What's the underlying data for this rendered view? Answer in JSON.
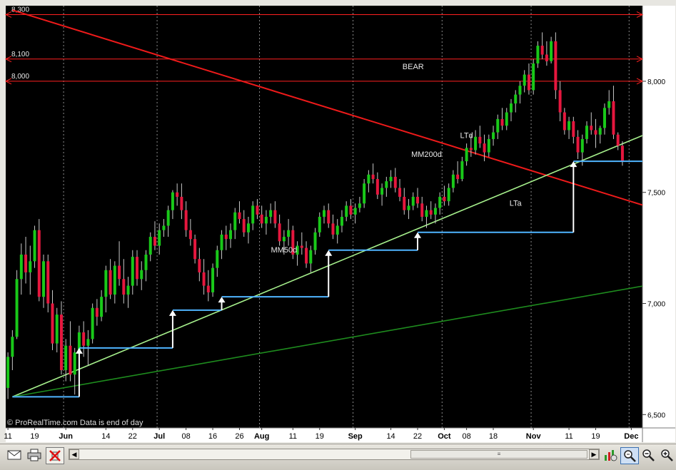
{
  "chart_data": {
    "type": "candlestick",
    "watermark": "© ProRealTime.com  Data is end of day",
    "y_axis": {
      "ticks": [
        6500,
        7000,
        7500,
        8000
      ],
      "tick_labels": [
        "6,500",
        "7,000",
        "7,500",
        "8,000"
      ],
      "range": [
        6440,
        8340
      ],
      "position": "right"
    },
    "x_axis": {
      "labels": [
        {
          "text": "11",
          "bar": 0
        },
        {
          "text": "19",
          "bar": 6
        },
        {
          "text": "Jun",
          "bar": 13,
          "bold": true
        },
        {
          "text": "14",
          "bar": 22
        },
        {
          "text": "22",
          "bar": 28
        },
        {
          "text": "Jul",
          "bar": 34,
          "bold": true
        },
        {
          "text": "08",
          "bar": 40
        },
        {
          "text": "16",
          "bar": 46
        },
        {
          "text": "26",
          "bar": 52
        },
        {
          "text": "Aug",
          "bar": 57,
          "bold": true
        },
        {
          "text": "11",
          "bar": 64
        },
        {
          "text": "19",
          "bar": 70
        },
        {
          "text": "Sep",
          "bar": 78,
          "bold": true
        },
        {
          "text": "14",
          "bar": 86
        },
        {
          "text": "22",
          "bar": 92
        },
        {
          "text": "Oct",
          "bar": 98,
          "bold": true
        },
        {
          "text": "08",
          "bar": 103
        },
        {
          "text": "18",
          "bar": 109
        },
        {
          "text": "Nov",
          "bar": 118,
          "bold": true
        },
        {
          "text": "11",
          "bar": 126
        },
        {
          "text": "19",
          "bar": 132
        },
        {
          "text": "Dec",
          "bar": 140,
          "bold": true
        }
      ],
      "month_separators": [
        13,
        34,
        57,
        78,
        98,
        118,
        140
      ],
      "total_bars": 143
    },
    "candles": [
      [
        6620,
        6780,
        6570,
        6760
      ],
      [
        6760,
        6880,
        6700,
        6850
      ],
      [
        6850,
        7150,
        6840,
        7110
      ],
      [
        7110,
        7270,
        7040,
        7220
      ],
      [
        7220,
        7300,
        7090,
        7140
      ],
      [
        7140,
        7260,
        7040,
        7190
      ],
      [
        7190,
        7350,
        7160,
        7330
      ],
      [
        7330,
        7380,
        7010,
        7030
      ],
      [
        7030,
        7220,
        6980,
        7190
      ],
      [
        7190,
        7220,
        6960,
        7000
      ],
      [
        7000,
        7060,
        6790,
        6820
      ],
      [
        6820,
        6980,
        6780,
        6950
      ],
      [
        6950,
        7010,
        6680,
        6700
      ],
      [
        6700,
        6840,
        6650,
        6810
      ],
      [
        6810,
        6920,
        6650,
        6680
      ],
      [
        6680,
        6800,
        6590,
        6780
      ],
      [
        6780,
        6900,
        6740,
        6870
      ],
      [
        6870,
        6920,
        6760,
        6810
      ],
      [
        6810,
        6880,
        6720,
        6840
      ],
      [
        6840,
        7000,
        6820,
        6980
      ],
      [
        6980,
        7020,
        6900,
        6940
      ],
      [
        6940,
        7060,
        6920,
        7030
      ],
      [
        7030,
        7170,
        6960,
        7150
      ],
      [
        7150,
        7200,
        7020,
        7040
      ],
      [
        7040,
        7190,
        7000,
        7170
      ],
      [
        7170,
        7280,
        7080,
        7110
      ],
      [
        7110,
        7200,
        7000,
        7040
      ],
      [
        7040,
        7120,
        6980,
        7080
      ],
      [
        7080,
        7240,
        7040,
        7210
      ],
      [
        7210,
        7240,
        7080,
        7110
      ],
      [
        7110,
        7190,
        7060,
        7150
      ],
      [
        7150,
        7240,
        7100,
        7220
      ],
      [
        7220,
        7320,
        7190,
        7300
      ],
      [
        7300,
        7370,
        7240,
        7260
      ],
      [
        7260,
        7360,
        7220,
        7330
      ],
      [
        7330,
        7380,
        7300,
        7350
      ],
      [
        7350,
        7440,
        7300,
        7420
      ],
      [
        7420,
        7510,
        7380,
        7500
      ],
      [
        7500,
        7540,
        7440,
        7480
      ],
      [
        7480,
        7540,
        7380,
        7420
      ],
      [
        7420,
        7460,
        7300,
        7330
      ],
      [
        7330,
        7380,
        7260,
        7290
      ],
      [
        7290,
        7310,
        7180,
        7200
      ],
      [
        7200,
        7250,
        7100,
        7140
      ],
      [
        7140,
        7200,
        7040,
        7080
      ],
      [
        7080,
        7150,
        7010,
        7050
      ],
      [
        7050,
        7180,
        7030,
        7160
      ],
      [
        7160,
        7260,
        7120,
        7240
      ],
      [
        7240,
        7330,
        7200,
        7310
      ],
      [
        7310,
        7350,
        7240,
        7290
      ],
      [
        7290,
        7360,
        7250,
        7330
      ],
      [
        7330,
        7430,
        7290,
        7410
      ],
      [
        7410,
        7460,
        7360,
        7380
      ],
      [
        7380,
        7420,
        7300,
        7320
      ],
      [
        7320,
        7390,
        7270,
        7360
      ],
      [
        7360,
        7460,
        7330,
        7440
      ],
      [
        7440,
        7470,
        7380,
        7400
      ],
      [
        7400,
        7440,
        7340,
        7360
      ],
      [
        7360,
        7420,
        7310,
        7390
      ],
      [
        7390,
        7450,
        7360,
        7420
      ],
      [
        7420,
        7460,
        7340,
        7360
      ],
      [
        7360,
        7400,
        7260,
        7280
      ],
      [
        7280,
        7330,
        7220,
        7300
      ],
      [
        7300,
        7380,
        7260,
        7330
      ],
      [
        7330,
        7350,
        7200,
        7220
      ],
      [
        7220,
        7280,
        7170,
        7260
      ],
      [
        7260,
        7320,
        7220,
        7250
      ],
      [
        7250,
        7280,
        7160,
        7180
      ],
      [
        7180,
        7260,
        7140,
        7240
      ],
      [
        7240,
        7340,
        7220,
        7320
      ],
      [
        7320,
        7410,
        7300,
        7390
      ],
      [
        7390,
        7440,
        7360,
        7420
      ],
      [
        7420,
        7450,
        7340,
        7360
      ],
      [
        7360,
        7400,
        7290,
        7310
      ],
      [
        7310,
        7380,
        7270,
        7350
      ],
      [
        7350,
        7420,
        7320,
        7390
      ],
      [
        7390,
        7460,
        7370,
        7440
      ],
      [
        7440,
        7470,
        7380,
        7400
      ],
      [
        7400,
        7450,
        7360,
        7430
      ],
      [
        7430,
        7480,
        7410,
        7450
      ],
      [
        7450,
        7560,
        7430,
        7540
      ],
      [
        7540,
        7600,
        7500,
        7580
      ],
      [
        7580,
        7630,
        7540,
        7560
      ],
      [
        7560,
        7590,
        7470,
        7490
      ],
      [
        7490,
        7540,
        7440,
        7520
      ],
      [
        7520,
        7570,
        7480,
        7550
      ],
      [
        7550,
        7600,
        7520,
        7570
      ],
      [
        7570,
        7610,
        7500,
        7520
      ],
      [
        7520,
        7560,
        7460,
        7480
      ],
      [
        7480,
        7520,
        7400,
        7420
      ],
      [
        7420,
        7470,
        7380,
        7440
      ],
      [
        7440,
        7500,
        7420,
        7480
      ],
      [
        7480,
        7520,
        7430,
        7450
      ],
      [
        7450,
        7480,
        7370,
        7390
      ],
      [
        7390,
        7440,
        7340,
        7420
      ],
      [
        7420,
        7460,
        7380,
        7400
      ],
      [
        7400,
        7450,
        7360,
        7430
      ],
      [
        7430,
        7500,
        7400,
        7480
      ],
      [
        7480,
        7530,
        7440,
        7460
      ],
      [
        7460,
        7540,
        7440,
        7520
      ],
      [
        7520,
        7600,
        7500,
        7580
      ],
      [
        7580,
        7640,
        7540,
        7560
      ],
      [
        7560,
        7660,
        7550,
        7640
      ],
      [
        7640,
        7720,
        7620,
        7700
      ],
      [
        7700,
        7760,
        7660,
        7690
      ],
      [
        7690,
        7780,
        7670,
        7750
      ],
      [
        7750,
        7800,
        7700,
        7720
      ],
      [
        7720,
        7760,
        7640,
        7680
      ],
      [
        7680,
        7760,
        7660,
        7740
      ],
      [
        7740,
        7800,
        7710,
        7770
      ],
      [
        7770,
        7850,
        7740,
        7830
      ],
      [
        7830,
        7880,
        7780,
        7800
      ],
      [
        7800,
        7880,
        7780,
        7860
      ],
      [
        7860,
        7920,
        7820,
        7900
      ],
      [
        7900,
        7960,
        7860,
        7940
      ],
      [
        7940,
        8000,
        7900,
        7980
      ],
      [
        7980,
        8050,
        7950,
        8030
      ],
      [
        8030,
        8080,
        7940,
        7960
      ],
      [
        7960,
        8100,
        7940,
        8080
      ],
      [
        8080,
        8180,
        8060,
        8160
      ],
      [
        8160,
        8220,
        8100,
        8120
      ],
      [
        8120,
        8180,
        8070,
        8090
      ],
      [
        8090,
        8200,
        8080,
        8180
      ],
      [
        8180,
        8220,
        7920,
        7960
      ],
      [
        7960,
        8000,
        7820,
        7860
      ],
      [
        7860,
        7880,
        7760,
        7780
      ],
      [
        7780,
        7840,
        7740,
        7820
      ],
      [
        7820,
        7840,
        7720,
        7750
      ],
      [
        7750,
        7780,
        7650,
        7680
      ],
      [
        7680,
        7760,
        7620,
        7740
      ],
      [
        7740,
        7820,
        7720,
        7800
      ],
      [
        7800,
        7860,
        7760,
        7780
      ],
      [
        7780,
        7830,
        7700,
        7760
      ],
      [
        7760,
        7800,
        7720,
        7790
      ],
      [
        7790,
        7900,
        7760,
        7880
      ],
      [
        7880,
        7960,
        7850,
        7910
      ],
      [
        7910,
        7980,
        7740,
        7760
      ],
      [
        7760,
        7770,
        7690,
        7710
      ],
      [
        7710,
        7730,
        7620,
        7640
      ]
    ],
    "candle_colors": {
      "up": "#19c919",
      "down": "#e6173e",
      "wick": "#c8c8c8"
    },
    "horizontal_levels": [
      {
        "value": 8300,
        "label": "8,300",
        "color": "#ff2020"
      },
      {
        "value": 8100,
        "label": "8,100",
        "color": "#ff2020"
      },
      {
        "value": 8000,
        "label": "8,000",
        "color": "#ff2020"
      }
    ],
    "annotations": [
      {
        "text": "BEAR",
        "bar": 91,
        "value": 8055
      },
      {
        "text": "LTd",
        "bar": 103,
        "value": 7745
      },
      {
        "text": "MM200d",
        "bar": 94,
        "value": 7660
      },
      {
        "text": "MM50d",
        "bar": 62,
        "value": 7230
      },
      {
        "text": "LTa",
        "bar": 114,
        "value": 7440
      }
    ],
    "trend_lines": [
      {
        "name": "LTd",
        "color": "#ee1a1a",
        "points": [
          [
            1,
            8320
          ],
          [
            143,
            7440
          ]
        ]
      },
      {
        "name": "LTa",
        "color": "#a6f08c",
        "points": [
          [
            1,
            6580
          ],
          [
            143,
            7760
          ]
        ]
      },
      {
        "name": "MM200d",
        "color": "#1e8c1e",
        "points": [
          [
            1,
            6580
          ],
          [
            143,
            7080
          ]
        ]
      }
    ],
    "staircase": {
      "color": "#4fb4ff",
      "steps": [
        [
          1,
          16,
          6580
        ],
        [
          16,
          37,
          6800
        ],
        [
          37,
          48,
          6970
        ],
        [
          48,
          72,
          7030
        ],
        [
          72,
          92,
          7240
        ],
        [
          92,
          127,
          7320
        ],
        [
          127,
          143,
          7640
        ]
      ],
      "arrows": [
        {
          "bar": 16,
          "from": 6580,
          "to": 6800
        },
        {
          "bar": 37,
          "from": 6800,
          "to": 6970
        },
        {
          "bar": 48,
          "from": 6970,
          "to": 7030
        },
        {
          "bar": 72,
          "from": 7030,
          "to": 7240
        },
        {
          "bar": 92,
          "from": 7240,
          "to": 7320
        },
        {
          "bar": 127,
          "from": 7320,
          "to": 7640
        }
      ]
    }
  },
  "toolbar": {
    "icons": [
      "mail-icon",
      "print-icon",
      "no-indicator-icon",
      "chart-settings-icon",
      "zoom-fit-icon",
      "zoom-out-icon",
      "zoom-in-icon"
    ]
  }
}
